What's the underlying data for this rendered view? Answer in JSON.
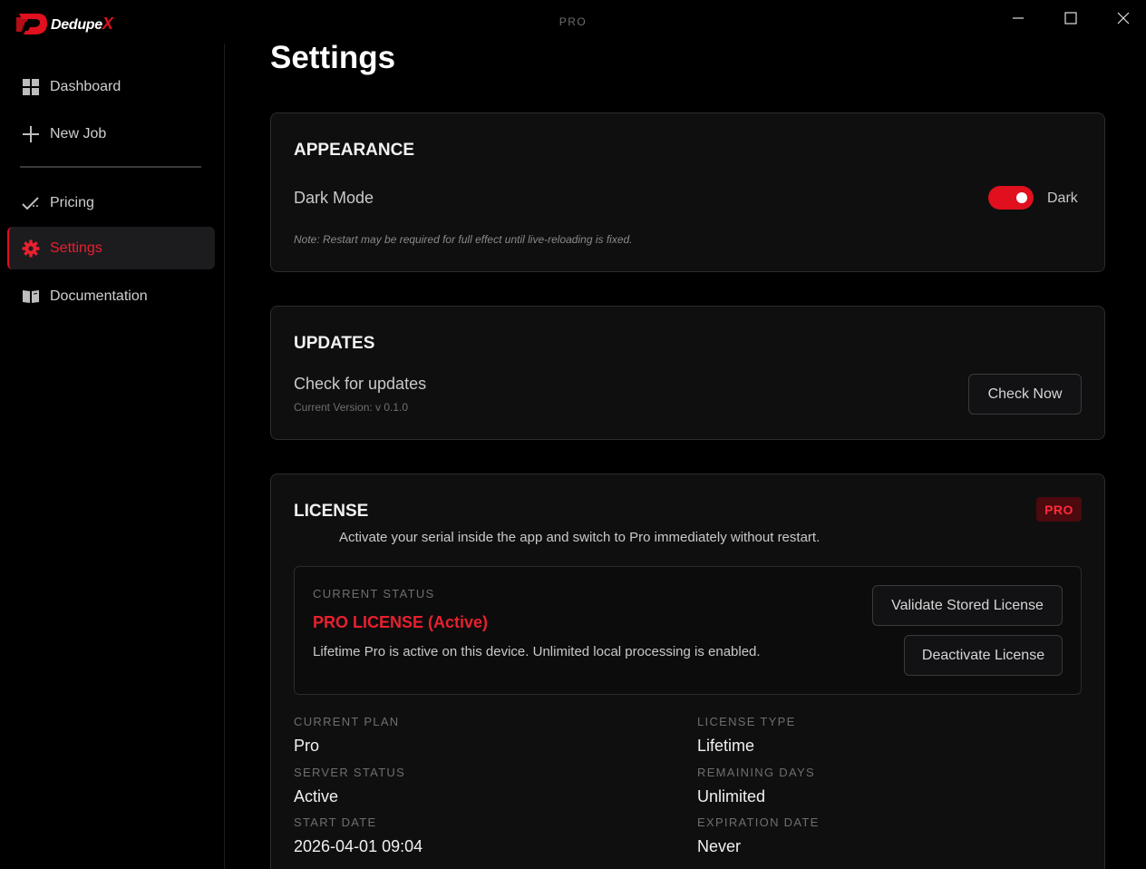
{
  "app": {
    "name_main": "Dedupe",
    "name_accent": "X",
    "window_title": "PRO"
  },
  "window_controls": {
    "minimize": "—",
    "maximize": "☐",
    "close": "✕"
  },
  "sidebar": {
    "items": [
      {
        "label": "Dashboard",
        "icon": "grid-icon"
      },
      {
        "label": "New Job",
        "icon": "plus-icon"
      },
      {
        "label": "Pricing",
        "icon": "check-trend-icon"
      },
      {
        "label": "Settings",
        "icon": "gear-icon",
        "active": true
      },
      {
        "label": "Documentation",
        "icon": "book-icon"
      }
    ]
  },
  "page": {
    "title": "Settings"
  },
  "appearance": {
    "title": "APPEARANCE",
    "dark_mode_label": "Dark Mode",
    "toggle_state": "Dark",
    "note": "Note: Restart may be required for full effect until live-reloading is fixed."
  },
  "updates": {
    "title": "UPDATES",
    "check_label": "Check for updates",
    "version": "Current Version: v 0.1.0",
    "check_button": "Check Now"
  },
  "license": {
    "title": "LICENSE",
    "badge": "PRO",
    "description": "Activate your serial inside the app and switch to Pro immediately without restart.",
    "status_label": "CURRENT STATUS",
    "status_value": "PRO LICENSE (Active)",
    "status_detail": "Lifetime Pro is active on this device. Unlimited local processing is enabled.",
    "validate_button": "Validate Stored License",
    "deactivate_button": "Deactivate License",
    "fields": {
      "current_plan_label": "CURRENT PLAN",
      "current_plan": "Pro",
      "license_type_label": "LICENSE TYPE",
      "license_type": "Lifetime",
      "server_status_label": "SERVER STATUS",
      "server_status": "Active",
      "remaining_days_label": "REMAINING DAYS",
      "remaining_days": "Unlimited",
      "start_date_label": "START DATE",
      "start_date": "2026-04-01 09:04",
      "expiration_date_label": "EXPIRATION DATE",
      "expiration_date": "Never"
    }
  },
  "colors": {
    "accent": "#e0101e",
    "background": "#000000",
    "card": "#0f0f10"
  }
}
